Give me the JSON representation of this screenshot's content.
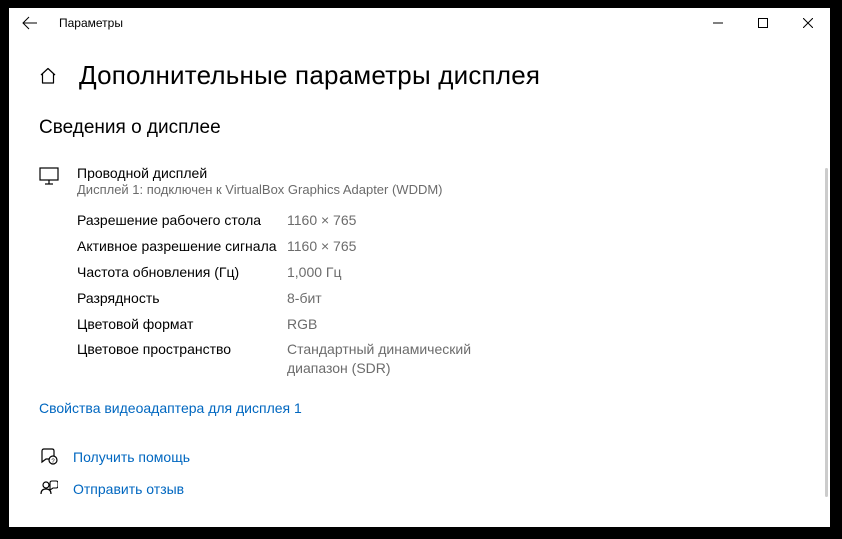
{
  "window_title": "Параметры",
  "page_title": "Дополнительные параметры дисплея",
  "section_title": "Сведения о дисплее",
  "display": {
    "name": "Проводной дисплей",
    "detail": "Дисплей 1: подключен к VirtualBox Graphics Adapter (WDDM)"
  },
  "specs": [
    {
      "label": "Разрешение рабочего стола",
      "value": "1160 × 765"
    },
    {
      "label": "Активное разрешение сигнала",
      "value": "1160 × 765"
    },
    {
      "label": "Частота обновления (Гц)",
      "value": "1,000 Гц"
    },
    {
      "label": "Разрядность",
      "value": "8-бит"
    },
    {
      "label": "Цветовой формат",
      "value": "RGB"
    },
    {
      "label": "Цветовое пространство",
      "value": "Стандартный динамический диапазон (SDR)"
    }
  ],
  "adapter_link": "Свойства видеоадаптера для дисплея 1",
  "help_link": "Получить помощь",
  "feedback_link": "Отправить отзыв"
}
